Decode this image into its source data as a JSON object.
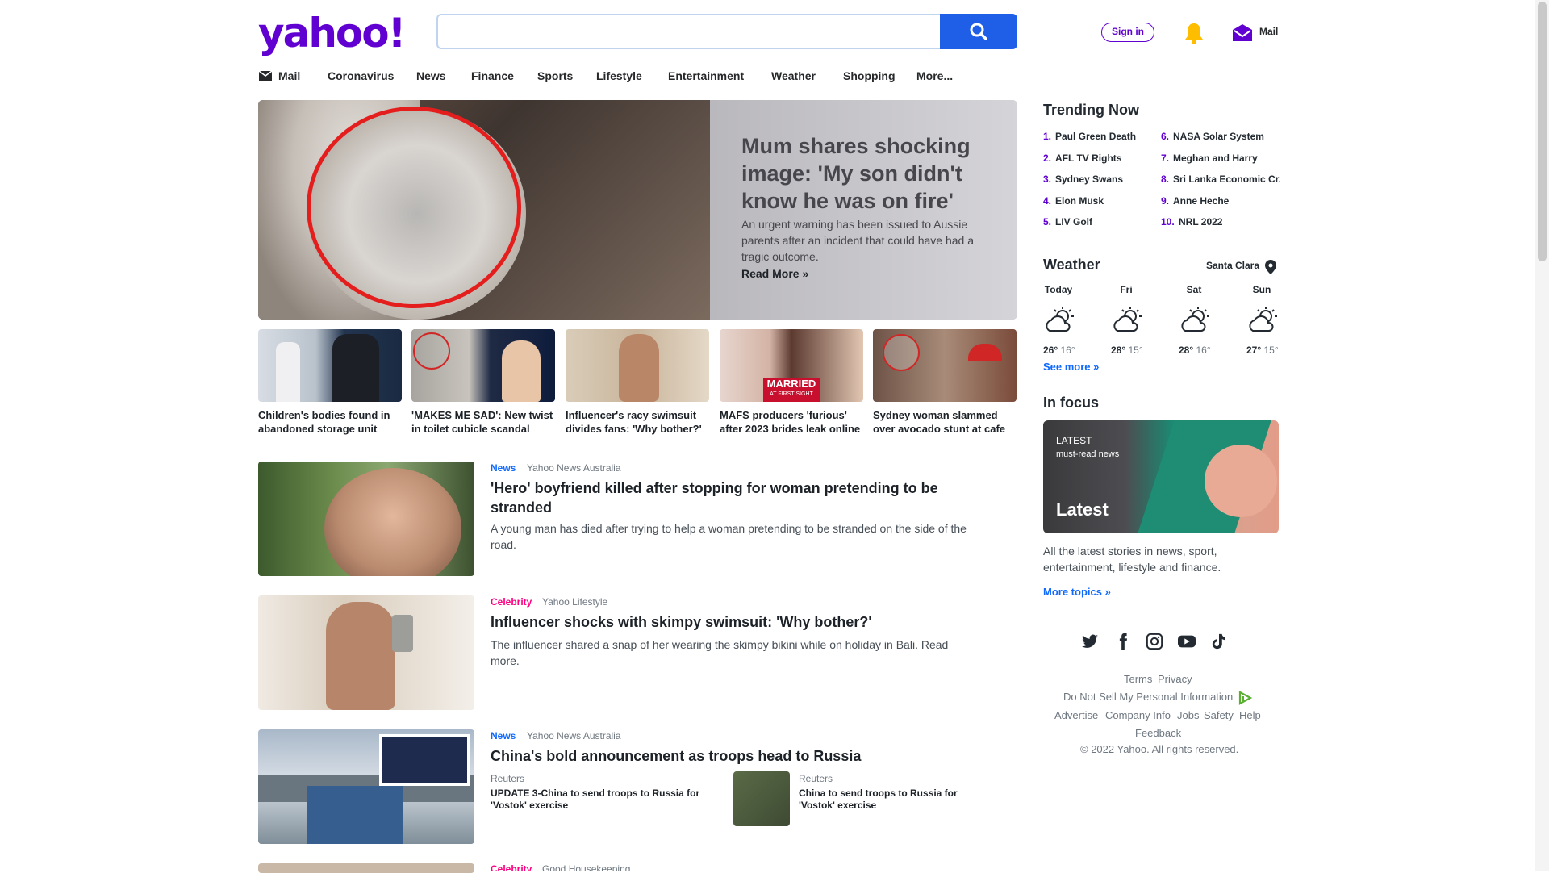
{
  "header": {
    "logo": "yahoo!",
    "search_value": "",
    "sign_in": "Sign in",
    "mail": "Mail"
  },
  "nav": [
    "Mail",
    "Coronavirus",
    "News",
    "Finance",
    "Sports",
    "Lifestyle",
    "Entertainment",
    "Weather",
    "Shopping",
    "More..."
  ],
  "hero": {
    "title": "Mum shares shocking image: 'My son didn't know he was on fire'",
    "desc": "An urgent warning has been issued to Aussie parents after an incident that could have had a tragic outcome.",
    "read_more": "Read More »"
  },
  "thumbs": [
    {
      "caption": "Children's bodies found in abandoned storage unit"
    },
    {
      "caption": "'MAKES ME SAD': New twist in toilet cubicle scandal"
    },
    {
      "caption": "Influencer's racy swimsuit divides fans: 'Why bother?'"
    },
    {
      "caption": "MAFS producers 'furious' after 2023 brides leak online",
      "overlay": "MARRIED",
      "overlay_sub": "AT FIRST SIGHT"
    },
    {
      "caption": "Sydney woman slammed over avocado stunt at cafe"
    }
  ],
  "stream": [
    {
      "category": "News",
      "cat_color": "#0f69ff",
      "source": "Yahoo News Australia",
      "title": "'Hero' boyfriend killed after stopping for woman pretending to be stranded",
      "desc": "A young man has died after trying to help a woman pretending to be stranded on the side of the road."
    },
    {
      "category": "Celebrity",
      "cat_color": "#ff0080",
      "source": "Yahoo Lifestyle",
      "title": "Influencer shocks with skimpy swimsuit: 'Why bother?'",
      "desc": "The influencer shared a snap of her wearing the skimpy bikini while on holiday in Bali. Read more."
    },
    {
      "category": "News",
      "cat_color": "#0f69ff",
      "source": "Yahoo News Australia",
      "title": "China's bold announcement as troops head to Russia",
      "related": [
        {
          "source": "Reuters",
          "title": "UPDATE 3-China to send troops to Russia for 'Vostok' exercise"
        },
        {
          "source": "Reuters",
          "title": "China to send troops to Russia for 'Vostok' exercise"
        }
      ]
    },
    {
      "category": "Celebrity",
      "cat_color": "#ff0080",
      "source": "Good Housekeeping"
    }
  ],
  "trending": {
    "title": "Trending Now",
    "items": [
      "Paul Green Death",
      "AFL TV Rights",
      "Sydney Swans",
      "Elon Musk",
      "LIV Golf",
      "NASA Solar System",
      "Meghan and Harry",
      "Sri Lanka Economic Cr...",
      "Anne Heche",
      "NRL 2022"
    ],
    "numbers": [
      "1.",
      "2.",
      "3.",
      "4.",
      "5.",
      "6.",
      "7.",
      "8.",
      "9.",
      "10."
    ]
  },
  "weather": {
    "title": "Weather",
    "location": "Santa Clara",
    "days": [
      {
        "day": "Today",
        "high": "26°",
        "low": "16°"
      },
      {
        "day": "Fri",
        "high": "28°",
        "low": "15°"
      },
      {
        "day": "Sat",
        "high": "28°",
        "low": "16°"
      },
      {
        "day": "Sun",
        "high": "27°",
        "low": "15°"
      }
    ],
    "see_more": "See more »"
  },
  "in_focus": {
    "title": "In focus",
    "label": "LATEST",
    "sub": "must-read news",
    "big": "Latest",
    "desc": "All the latest stories in news, sport, entertainment, lifestyle and finance.",
    "more": "More topics »"
  },
  "footer": {
    "row1": [
      "Terms",
      "Privacy"
    ],
    "row2": "Do Not Sell My Personal Information",
    "row3": [
      "Advertise",
      "Company Info",
      "Jobs",
      "Safety",
      "Help"
    ],
    "row4": "Feedback",
    "copyright": "© 2022 Yahoo. All rights reserved."
  },
  "colors": {
    "brand": "#6001d2",
    "search_button": "#1f5fe8",
    "link": "#0f69ff"
  },
  "icons": [
    "search-icon",
    "bell-icon",
    "mail-icon",
    "location-pin-icon",
    "partly-cloudy-icon",
    "twitter-icon",
    "facebook-icon",
    "instagram-icon",
    "youtube-icon",
    "tiktok-icon",
    "adchoices-icon"
  ]
}
